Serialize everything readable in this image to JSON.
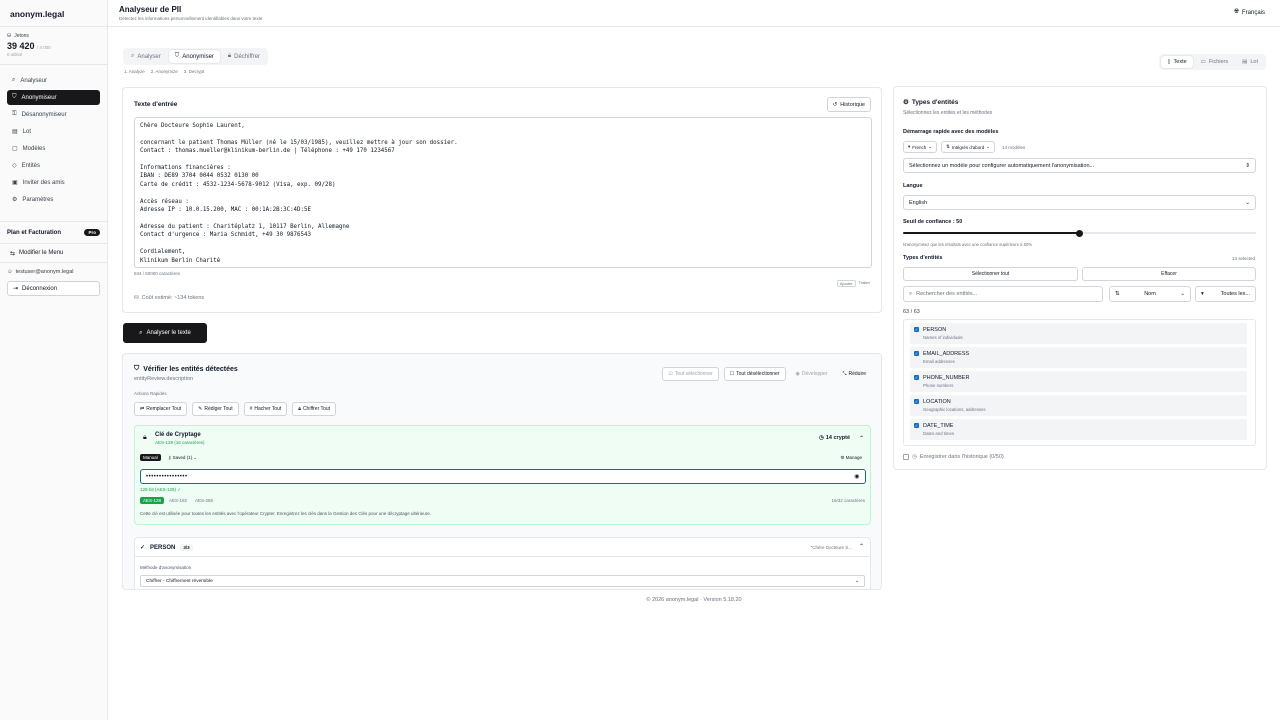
{
  "app": {
    "brand": "anonym.legal"
  },
  "tokens": {
    "label": "Jetons",
    "value": "39 420",
    "limit": "/ 4 000",
    "used": "0 utilisé"
  },
  "nav": [
    {
      "label": "Analyseur",
      "icon": "search-icon"
    },
    {
      "label": "Anonymiseur",
      "icon": "shield-icon",
      "active": true
    },
    {
      "label": "Désanonymiseur",
      "icon": "unlock-icon"
    },
    {
      "label": "Lot",
      "icon": "layers-icon"
    },
    {
      "label": "Modèles",
      "icon": "template-icon"
    },
    {
      "label": "Entités",
      "icon": "tag-icon"
    },
    {
      "label": "Inviter des amis",
      "icon": "gift-icon"
    },
    {
      "label": "Paramètres",
      "icon": "gear-icon"
    }
  ],
  "plan": {
    "label": "Plan et Facturation",
    "badge": "Pro"
  },
  "modify_menu": "Modifier le Menu",
  "user": {
    "email": "testuser@anonym.legal",
    "logout": "Déconnexion"
  },
  "header": {
    "title": "Analyseur de PII",
    "subtitle": "Détectez les informations personnellement identifiables dans votre texte",
    "language": "Français"
  },
  "tabs": [
    {
      "label": "Analyser",
      "icon": "search-icon"
    },
    {
      "label": "Anonymiser",
      "icon": "shield-icon",
      "active": true
    },
    {
      "label": "Déchiffrer",
      "icon": "lock-icon"
    }
  ],
  "steps": [
    "1. Analyze",
    "2. Anonymize",
    "3. Decrypt"
  ],
  "mode_tabs": [
    {
      "label": "Texte",
      "active": true
    },
    {
      "label": "Fichiers"
    },
    {
      "label": "Lot"
    }
  ],
  "input": {
    "title": "Texte d'entrée",
    "history_button": "Historique",
    "text": "Chère Docteure Sophie Laurent,\n\nconcernant le patient Thomas Müller (né le 15/03/1985), veuillez mettre à jour son dossier.\nContact : thomas.mueller@klinikum-berlin.de | Téléphone : +49 170 1234567\n\nInformations financières :\nIBAN : DE89 3704 0044 0532 0130 00\nCarte de crédit : 4532-1234-5678-9012 (Visa, exp. 09/28)\n\nAccès réseau :\nAdresse IP : 10.0.15.200, MAC : 00:1A:2B:3C:4D:5E\n\nAdresse du patient : Charitéplatz 1, 10117 Berlin, Allemagne\nContact d'urgence : Maria Schmidt, +49 30 9876543\n\nCordialement,\nKlinikum Berlin Charité",
    "char_count": "534 / 50000 caractères",
    "actions": [
      "Ajouter",
      "Traiter"
    ],
    "cost": "Coût estimé: ~134 tokens"
  },
  "analyze_button": "Analyser le texte",
  "review": {
    "title": "Vérifier les entités détectées",
    "description": "entityReview.description",
    "buttons": [
      "Tout sélectionner",
      "Tout désélectionner",
      "Développer",
      "Réduire"
    ],
    "quick_label": "Actions Rapides",
    "quick_actions": [
      "Remplacer Tout",
      "Rédiger Tout",
      "Hacher Tout",
      "Chiffrer Tout"
    ],
    "crypto": {
      "title": "Clé de Cryptage",
      "subtitle": "AES-128 (16 caractères)",
      "count": "14 crypté",
      "mode": "Manual",
      "saved": "Saved (1)",
      "manage": "Manage",
      "key_mask": "••••••••••••••••",
      "bits": "128-bit (AES-128) ✓",
      "algos": [
        "AES-128",
        "AES-192",
        "AES-256"
      ],
      "chars": "16/32 caractères",
      "note": "Cette clé est utilisée pour toutes les entités avec l'opérateur Crypter. Enregistrez les clés dans la Gestion des Clés pour une décryptage ultérieure."
    },
    "person": {
      "name": "PERSON",
      "count": "3/3",
      "preview": "\"Chère Docteure S...",
      "method_label": "Méthode d'anonymisation",
      "method_value": "Chiffrer - Chiffrement réversible"
    }
  },
  "entity_panel": {
    "title": "Types d'entités",
    "subtitle": "Sélectionnez les entités et les méthodes",
    "quickstart_label": "Démarrage rapide avec des modèles",
    "chips": [
      "French",
      "Intégrés d'abord"
    ],
    "model_count": "14 modèles",
    "model_select": "Sélectionnez un modèle pour configurer automatiquement l'anonymisation...",
    "language_label": "Langue",
    "language_value": "English",
    "confidence_label": "Seuil de confiance : 50",
    "confidence": 0.5,
    "hint": "N'anonymisez que les résultats avec une confiance supérieure à 50%",
    "types_label": "Types d'entités",
    "selected": "13 selected",
    "select_all": "Sélectionner tout",
    "clear": "Effacer",
    "search_placeholder": "Rechercher des entités...",
    "sort": "Nom",
    "filter": "Toutes les...",
    "count": "63 / 63",
    "entities": [
      {
        "name": "PERSON",
        "desc": "Names of individuals"
      },
      {
        "name": "EMAIL_ADDRESS",
        "desc": "Email addresses"
      },
      {
        "name": "PHONE_NUMBER",
        "desc": "Phone numbers"
      },
      {
        "name": "LOCATION",
        "desc": "Geographic locations, addresses"
      },
      {
        "name": "DATE_TIME",
        "desc": "Dates and times"
      }
    ],
    "save_history": "Enregistrer dans l'historique (0/50)"
  },
  "footer": "© 2026 anonym.legal · Version 5.18.20"
}
